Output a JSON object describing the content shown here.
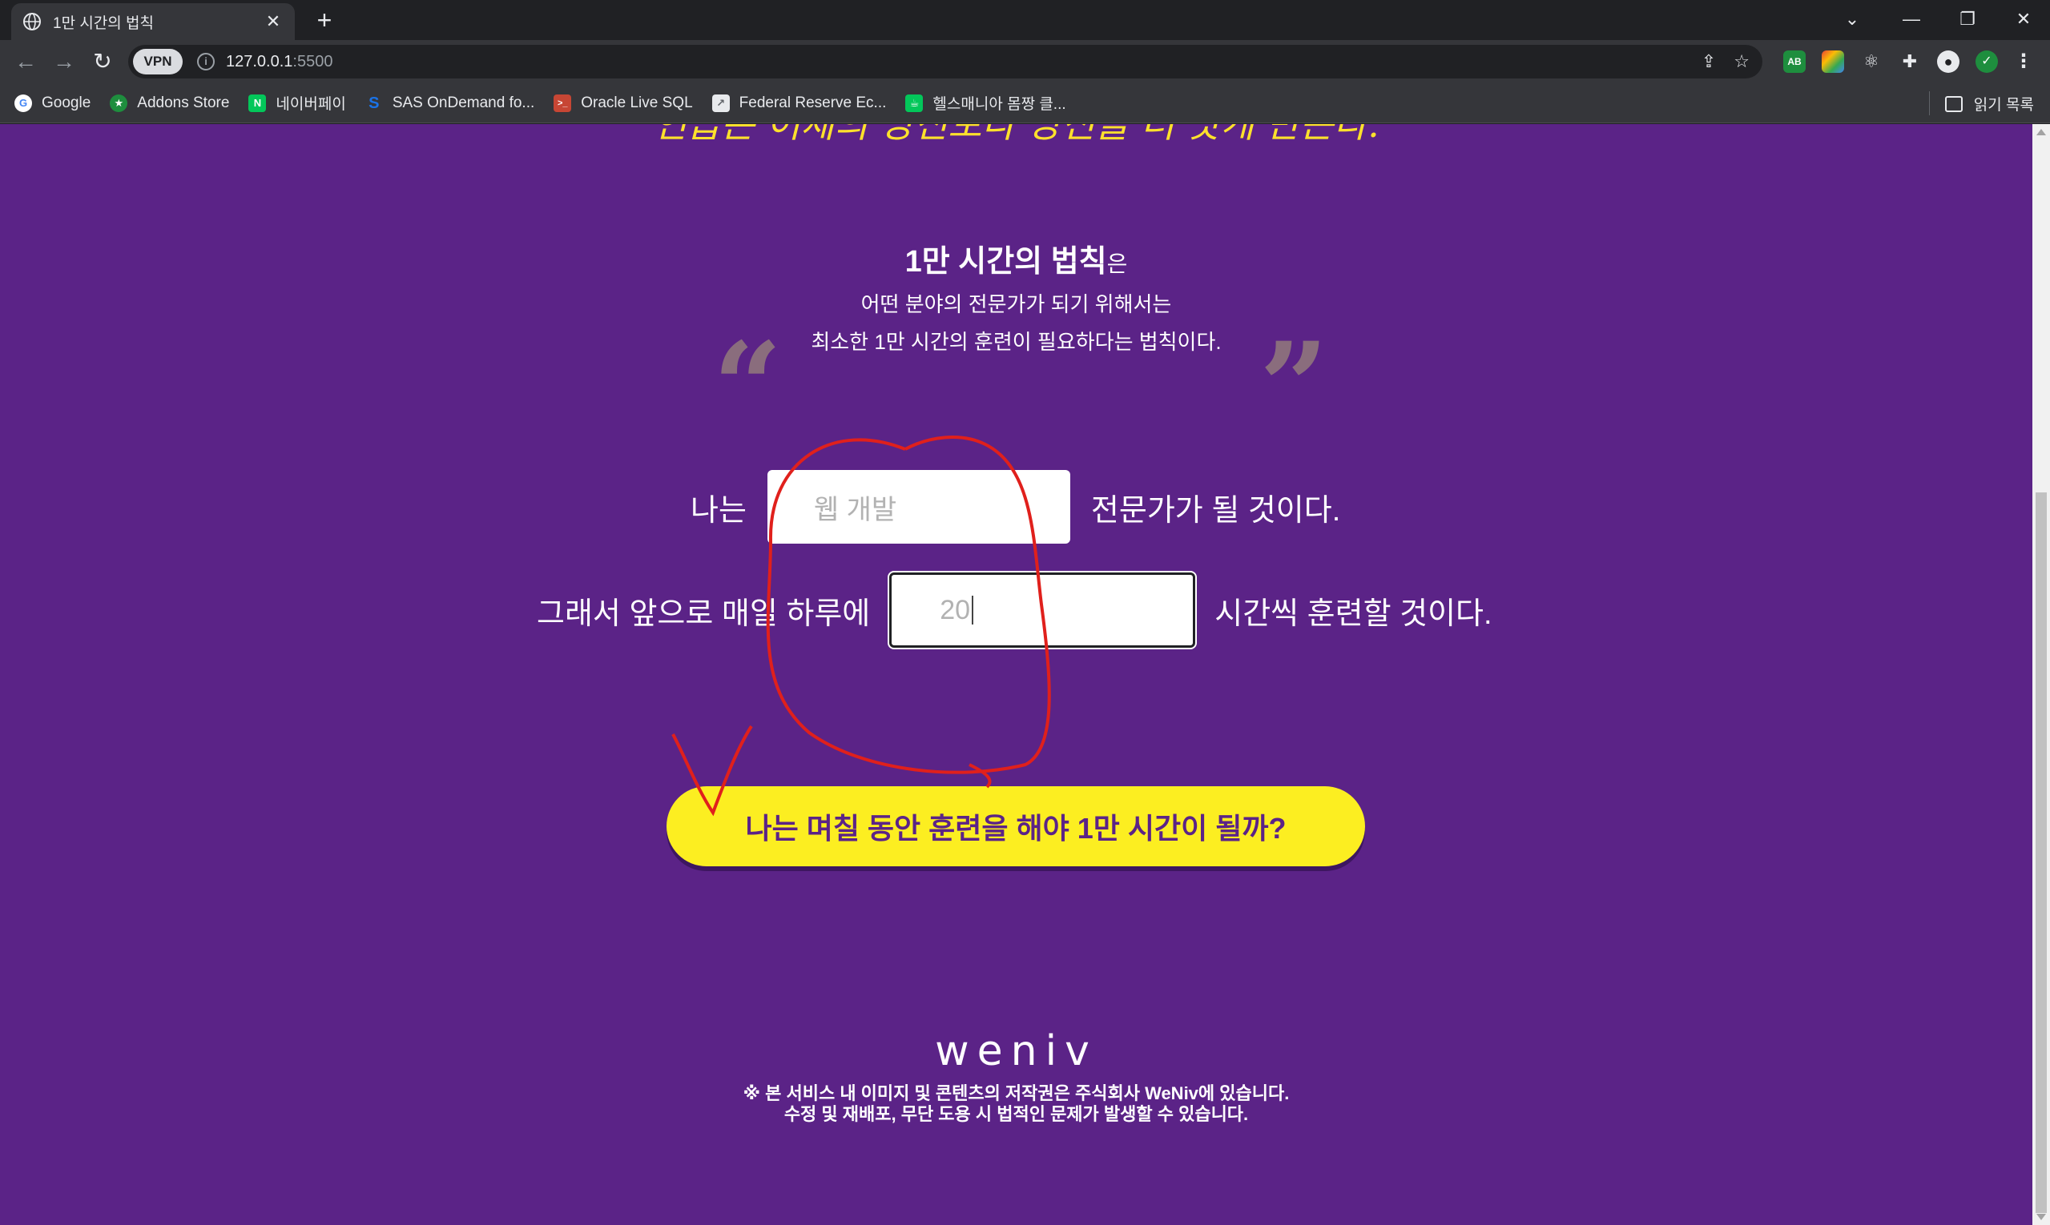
{
  "browser": {
    "tab_title": "1만 시간의 법칙",
    "new_tab": "+",
    "url_host": "127.0.0.1",
    "url_port": ":5500",
    "vpn_label": "VPN",
    "window_controls": {
      "dropdown": "⌄",
      "minimize": "—",
      "restore": "❐",
      "close": "✕"
    },
    "bookmarks": [
      {
        "label": "Google",
        "icon": "google-icon",
        "color": "#ffffff"
      },
      {
        "label": "Addons Store",
        "icon": "addons-store-icon",
        "color": "#1e8e3e"
      },
      {
        "label": "네이버페이",
        "icon": "naver-pay-icon",
        "color": "#03c75a"
      },
      {
        "label": "SAS OnDemand fo...",
        "icon": "sas-icon",
        "color": "#1a73e8"
      },
      {
        "label": "Oracle Live SQL",
        "icon": "oracle-icon",
        "color": "#c74634"
      },
      {
        "label": "Federal Reserve Ec...",
        "icon": "chart-icon",
        "color": "#5f6368"
      },
      {
        "label": "헬스매니아 몸짱 클...",
        "icon": "health-icon",
        "color": "#03c75a"
      }
    ],
    "reading_list": "읽기 목록"
  },
  "page": {
    "top_quote": "연습은 어제의 당신보다 당신을 더 낫게 만든다.",
    "quote": {
      "title": "1만 시간의 법칙",
      "title_suffix": "은",
      "line1": "어떤 분야의 전문가가 되기 위해서는",
      "line2": "최소한 1만 시간의 훈련이 필요하다는 법칙이다."
    },
    "form": {
      "prefix1": "나는",
      "field_placeholder": "웹 개발",
      "suffix1": "전문가가 될 것이다.",
      "prefix2": "그래서 앞으로 매일 하루에",
      "hours_placeholder": "20",
      "suffix2": "시간씩 훈련할 것이다."
    },
    "cta_label": "나는 며칠 동안 훈련을 해야 1만 시간이 될까?",
    "logo": "weniv",
    "copyright_line1": "※ 본 서비스 내 이미지 및 콘텐츠의 저작권은 주식회사 WeNiv에 있습니다.",
    "copyright_line2": "수정 및 재배포, 무단 도용 시 법적인 문제가 발생할 수 있습니다."
  },
  "colors": {
    "background": "#5b2387",
    "accent_yellow": "#fcee21",
    "annotation_red": "#e0201c"
  }
}
